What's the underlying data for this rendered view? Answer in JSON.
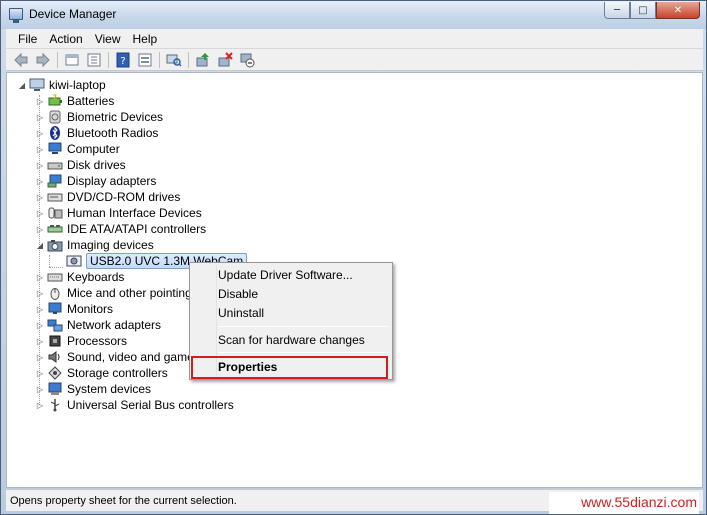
{
  "window": {
    "title": "Device Manager",
    "caption_buttons": [
      "minimize",
      "maximize",
      "close"
    ]
  },
  "menu": [
    "File",
    "Action",
    "View",
    "Help"
  ],
  "toolbar": [
    "back-icon",
    "forward-icon",
    "up-icon",
    "show-hide-tree-icon",
    "help-icon",
    "properties-icon",
    "scan-hardware-icon",
    "update-driver-icon",
    "uninstall-icon",
    "disable-icon"
  ],
  "tree": {
    "root": "kiwi-laptop",
    "categories": [
      {
        "label": "Batteries",
        "icon": "battery-icon"
      },
      {
        "label": "Biometric Devices",
        "icon": "biometric-icon"
      },
      {
        "label": "Bluetooth Radios",
        "icon": "bluetooth-icon"
      },
      {
        "label": "Computer",
        "icon": "computer-icon"
      },
      {
        "label": "Disk drives",
        "icon": "disk-drive-icon"
      },
      {
        "label": "Display adapters",
        "icon": "display-adapter-icon"
      },
      {
        "label": "DVD/CD-ROM drives",
        "icon": "dvd-drive-icon"
      },
      {
        "label": "Human Interface Devices",
        "icon": "hid-icon"
      },
      {
        "label": "IDE ATA/ATAPI controllers",
        "icon": "ide-controller-icon"
      },
      {
        "label": "Imaging devices",
        "icon": "camera-icon",
        "expanded": true
      },
      {
        "label": "USB2.0 UVC 1.3M WebCam",
        "icon": "webcam-icon",
        "child": true,
        "selected": true
      },
      {
        "label": "Keyboards",
        "icon": "keyboard-icon"
      },
      {
        "label": "Mice and other pointing d",
        "icon": "mouse-icon"
      },
      {
        "label": "Monitors",
        "icon": "monitor-icon"
      },
      {
        "label": "Network adapters",
        "icon": "network-icon"
      },
      {
        "label": "Processors",
        "icon": "processor-icon"
      },
      {
        "label": "Sound, video and game c",
        "icon": "sound-icon"
      },
      {
        "label": "Storage controllers",
        "icon": "storage-icon"
      },
      {
        "label": "System devices",
        "icon": "system-icon"
      },
      {
        "label": "Universal Serial Bus controllers",
        "icon": "usb-icon"
      }
    ]
  },
  "context_menu": {
    "items": [
      "Update Driver Software...",
      "Disable",
      "Uninstall",
      "Scan for hardware changes",
      "Properties"
    ],
    "highlighted": "Properties",
    "highlight_color": "#d71920"
  },
  "status": "Opens property sheet for the current selection.",
  "watermark": "www.55dianzi.com"
}
